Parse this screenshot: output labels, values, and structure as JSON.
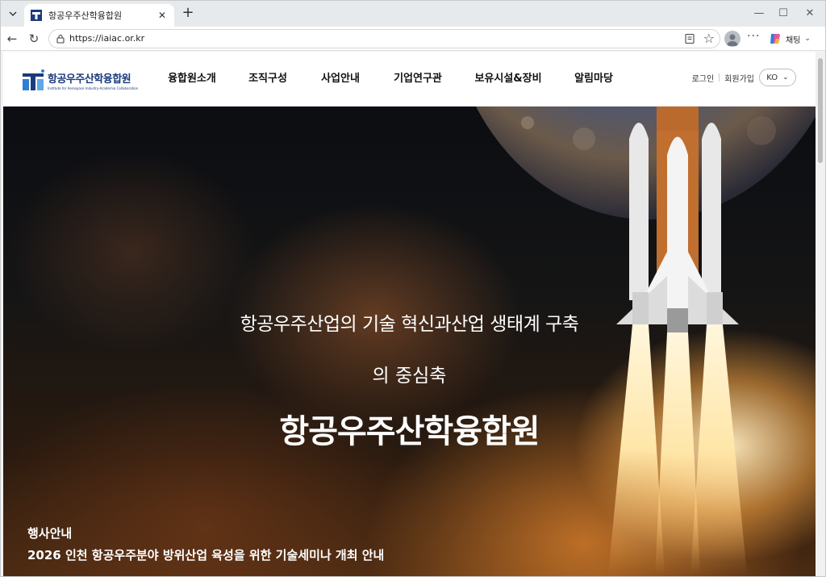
{
  "browser": {
    "tab_title": "항공우주산학융합원",
    "url": "https://iaiac.or.kr",
    "copilot_label": "채팅"
  },
  "site": {
    "logo_name": "항공우주산학융합원",
    "logo_sub": "Institute for Aerospace Industry-Academia Collaboration",
    "nav": [
      "융합원소개",
      "조직구성",
      "사업안내",
      "기업연구관",
      "보유시설&장비",
      "알림마당"
    ],
    "login": "로그인",
    "signup": "회원가입",
    "lang": "KO"
  },
  "hero": {
    "line1": "항공우주산업의 기술 혁신과산업 생태계 구축",
    "line2": "의 중심축",
    "title": "항공우주산학융합원"
  },
  "notice": {
    "category": "행사안내",
    "headline": "2026 인천 항공우주분야 방위산업 육성을 위한 기술세미나 개최 안내"
  },
  "colors": {
    "brand": "#1a3a7d",
    "accent": "#2f7fd6"
  }
}
